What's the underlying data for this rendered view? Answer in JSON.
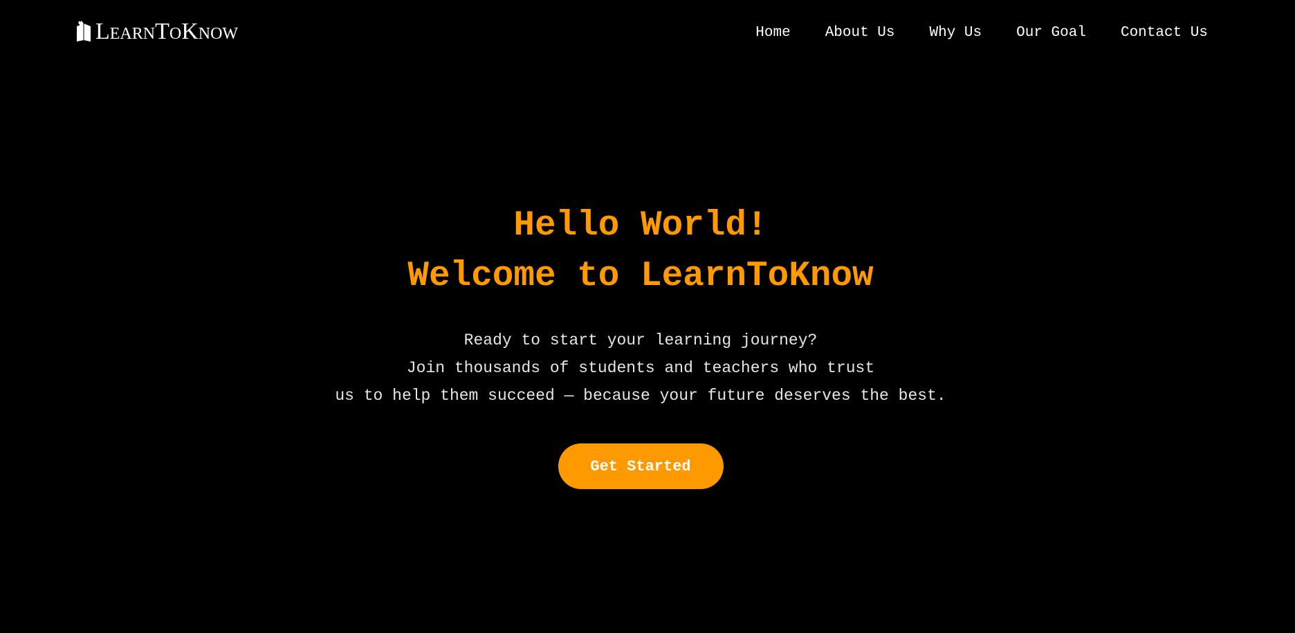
{
  "brand": {
    "name": "LearnToKnow",
    "icon": "book-icon"
  },
  "nav": {
    "items": [
      {
        "label": "Home"
      },
      {
        "label": "About Us"
      },
      {
        "label": "Why Us"
      },
      {
        "label": "Our Goal"
      },
      {
        "label": "Contact Us"
      }
    ]
  },
  "hero": {
    "heading_line1": "Hello World!",
    "heading_line2": "Welcome to LearnToKnow",
    "tagline_line1": "Ready to start your learning journey?",
    "tagline_line2": "Join thousands of students and teachers who trust",
    "tagline_line3": "us to help them succeed — because your future deserves the best.",
    "cta_label": "Get Started"
  },
  "colors": {
    "background": "#000000",
    "accent": "#ff9900",
    "text": "#ffffff"
  }
}
